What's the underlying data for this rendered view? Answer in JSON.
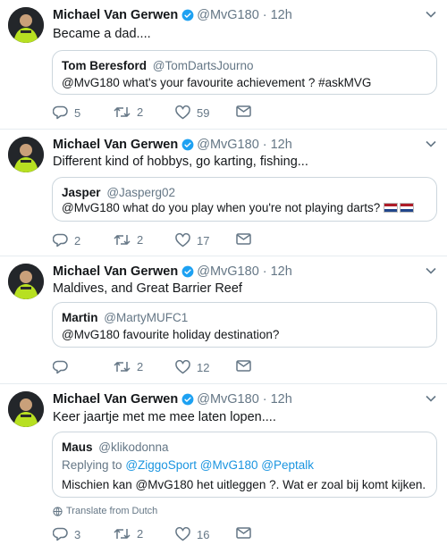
{
  "tweets": [
    {
      "author": {
        "name": "Michael Van Gerwen",
        "handle": "@MvG180",
        "time": "12h"
      },
      "text": "Became a dad....",
      "quote": {
        "name": "Tom Beresford",
        "handle": "@TomDartsJourno",
        "text": "@MvG180 what's your favourite achievement ? #askMVG"
      },
      "actions": {
        "replies": "5",
        "retweets": "2",
        "likes": "59"
      }
    },
    {
      "author": {
        "name": "Michael Van Gerwen",
        "handle": "@MvG180",
        "time": "12h"
      },
      "text": "Different kind of hobbys, go karting, fishing...",
      "quote": {
        "name": "Jasper",
        "handle": "@Jasperg02",
        "text": "@MvG180 what do you play when you're not playing darts?"
      },
      "actions": {
        "replies": "2",
        "retweets": "2",
        "likes": "17"
      }
    },
    {
      "author": {
        "name": "Michael Van Gerwen",
        "handle": "@MvG180",
        "time": "12h"
      },
      "text": "Maldives, and Great Barrier Reef",
      "quote": {
        "name": "Martin",
        "handle": "@MartyMUFC1",
        "text": "@MvG180 favourite holiday destination?"
      },
      "actions": {
        "replies": "",
        "retweets": "2",
        "likes": "12"
      }
    },
    {
      "author": {
        "name": "Michael Van Gerwen",
        "handle": "@MvG180",
        "time": "12h"
      },
      "text": "Keer jaartje met me mee laten lopen....",
      "quote": {
        "name": "Maus",
        "handle": "@klikodonna",
        "replying_prefix": "Replying to",
        "replying_to": "@ZiggoSport @MvG180 @Peptalk",
        "text": "Mischien kan @MvG180  het uitleggen ?. Wat er zoal bij komt kijken."
      },
      "translate": "Translate from Dutch",
      "actions": {
        "replies": "3",
        "retweets": "2",
        "likes": "16"
      }
    }
  ],
  "icons": {
    "verified": "verified-badge-icon",
    "reply": "reply-icon",
    "retweet": "retweet-icon",
    "like": "heart-icon",
    "dm": "envelope-icon",
    "more": "chevron-down-icon",
    "globe": "globe-icon"
  },
  "colors": {
    "verified": "#1da1f2",
    "muted": "#657786",
    "mention": "#1b95e0",
    "border": "#ccd6dd",
    "flag_red": "#ae1c28",
    "flag_blue": "#21468b"
  }
}
